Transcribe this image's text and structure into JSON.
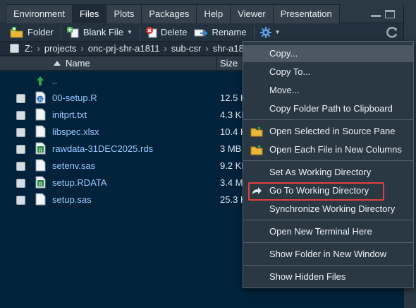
{
  "tabs": [
    {
      "label": "Environment",
      "active": false
    },
    {
      "label": "Files",
      "active": true
    },
    {
      "label": "Plots",
      "active": false
    },
    {
      "label": "Packages",
      "active": false
    },
    {
      "label": "Help",
      "active": false
    },
    {
      "label": "Viewer",
      "active": false
    },
    {
      "label": "Presentation",
      "active": false
    }
  ],
  "toolbar": {
    "new_folder": "Folder",
    "blank_file": "Blank File",
    "delete": "Delete",
    "rename": "Rename"
  },
  "breadcrumb": [
    "Z:",
    "projects",
    "onc-prj-shr-a1811",
    "sub-csr",
    "shr-a18"
  ],
  "columns": {
    "name": "Name",
    "size": "Size"
  },
  "files": [
    {
      "name": "..",
      "size": "",
      "icon": "up-arrow-icon"
    },
    {
      "name": "00-setup.R",
      "size": "12.5 K",
      "icon": "r-script-icon"
    },
    {
      "name": "initprt.txt",
      "size": "4.3 KE",
      "icon": "text-file-icon"
    },
    {
      "name": "libspec.xlsx",
      "size": "10.4 K",
      "icon": "text-file-icon"
    },
    {
      "name": "rawdata-31DEC2025.rds",
      "size": "3 MB",
      "icon": "r-data-icon"
    },
    {
      "name": "setenv.sas",
      "size": "9.2 KE",
      "icon": "text-file-icon"
    },
    {
      "name": "setup.RDATA",
      "size": "3.4 M",
      "icon": "r-data-icon"
    },
    {
      "name": "setup.sas",
      "size": "25.3 K",
      "icon": "text-file-icon"
    }
  ],
  "menu": {
    "copy": "Copy...",
    "copy_to": "Copy To...",
    "move": "Move...",
    "copy_path": "Copy Folder Path to Clipboard",
    "open_source": "Open Selected in Source Pane",
    "open_columns": "Open Each File in New Columns",
    "set_wd": "Set As Working Directory",
    "go_wd": "Go To Working Directory",
    "sync_wd": "Synchronize Working Directory",
    "terminal": "Open New Terminal Here",
    "show_folder": "Show Folder in New Window",
    "hidden": "Show Hidden Files"
  },
  "colors": {
    "accent_highlight": "#e0403f",
    "link": "#9cc9ff",
    "background": "#00223a"
  }
}
